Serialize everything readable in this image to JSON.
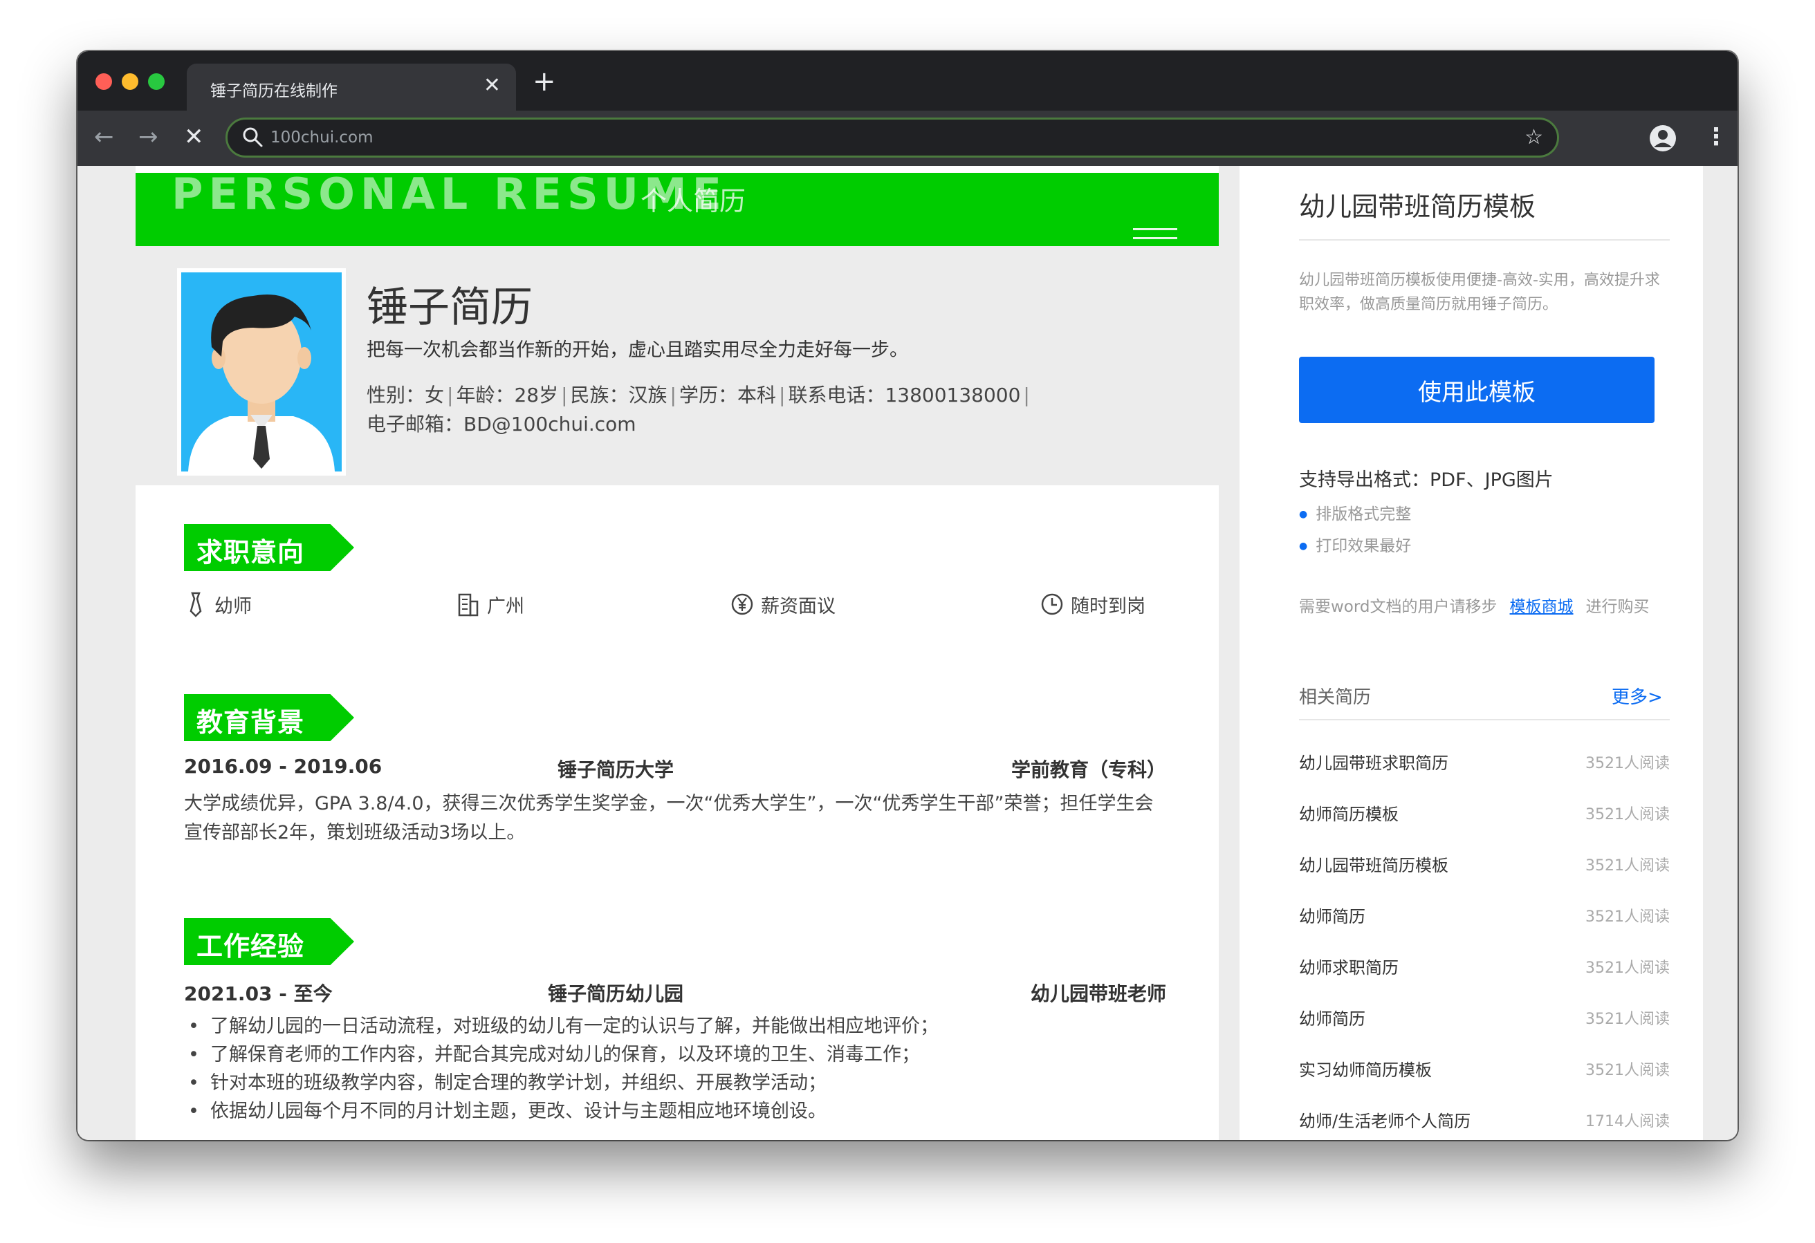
{
  "browser": {
    "tab_title": "锤子简历在线制作",
    "url": "100chui.com",
    "close_glyph": "✕",
    "new_tab_glyph": "+"
  },
  "resume": {
    "banner_en": "PERSONAL RESUME",
    "banner_cn": "个人简历",
    "name": "锤子简历",
    "motto": "把每一次机会都当作新的开始，虚心且踏实用尽全力走好每一步。",
    "info": {
      "gender": "性别：女",
      "age": "年龄：28岁",
      "ethnicity": "民族：汉族",
      "education": "学历：本科",
      "phone": "联系电话：13800138000",
      "email": "电子邮箱：BD@100chui.com"
    },
    "intent": {
      "title": "求职意向",
      "position": "幼师",
      "city": "广州",
      "salary": "薪资面议",
      "availability": "随时到岗"
    },
    "education": {
      "title": "教育背景",
      "period": "2016.09 - 2019.06",
      "school": "锤子简历大学",
      "major": "学前教育（专科）",
      "description": "大学成绩优异，GPA 3.8/4.0，获得三次优秀学生奖学金，一次“优秀大学生”，一次“优秀学生干部”荣誉；担任学生会宣传部部长2年，策划班级活动3场以上。"
    },
    "work": {
      "title": "工作经验",
      "period": "2021.03 - 至今",
      "company": "锤子简历幼儿园",
      "role": "幼儿园带班老师",
      "duties": [
        "了解幼儿园的一日活动流程，对班级的幼儿有一定的认识与了解，并能做出相应地评价；",
        "了解保育老师的工作内容，并配合其完成对幼儿的保育，以及环境的卫生、消毒工作；",
        "针对本班的班级教学内容，制定合理的教学计划，并组织、开展教学活动；",
        "依据幼儿园每个月不同的月计划主题，更改、设计与主题相应地环境创设。"
      ]
    }
  },
  "sidebar": {
    "title": "幼儿园带班简历模板",
    "description": "幼儿园带班简历模板使用便捷-高效-实用，高效提升求职效率，做高质量简历就用锤子简历。",
    "use_button": "使用此模板",
    "formats": "支持导出格式：PDF、JPG图片",
    "features": [
      "排版格式完整",
      "打印效果最好"
    ],
    "word_prefix": "需要word文档的用户请移步",
    "word_link": "模板商城",
    "word_suffix": "进行购买",
    "related_title": "相关简历",
    "more": "更多>",
    "related": [
      {
        "title": "幼儿园带班求职简历",
        "reads": "3521人阅读"
      },
      {
        "title": "幼师简历模板",
        "reads": "3521人阅读"
      },
      {
        "title": "幼儿园带班简历模板",
        "reads": "3521人阅读"
      },
      {
        "title": "幼师简历",
        "reads": "3521人阅读"
      },
      {
        "title": "幼师求职简历",
        "reads": "3521人阅读"
      },
      {
        "title": "幼师简历",
        "reads": "3521人阅读"
      },
      {
        "title": "实习幼师简历模板",
        "reads": "3521人阅读"
      },
      {
        "title": "幼师/生活老师个人简历",
        "reads": "1714人阅读"
      }
    ]
  },
  "colors": {
    "accent_green": "#00cc00",
    "button_blue": "#0c6cf2",
    "chrome_dark": "#202124"
  }
}
